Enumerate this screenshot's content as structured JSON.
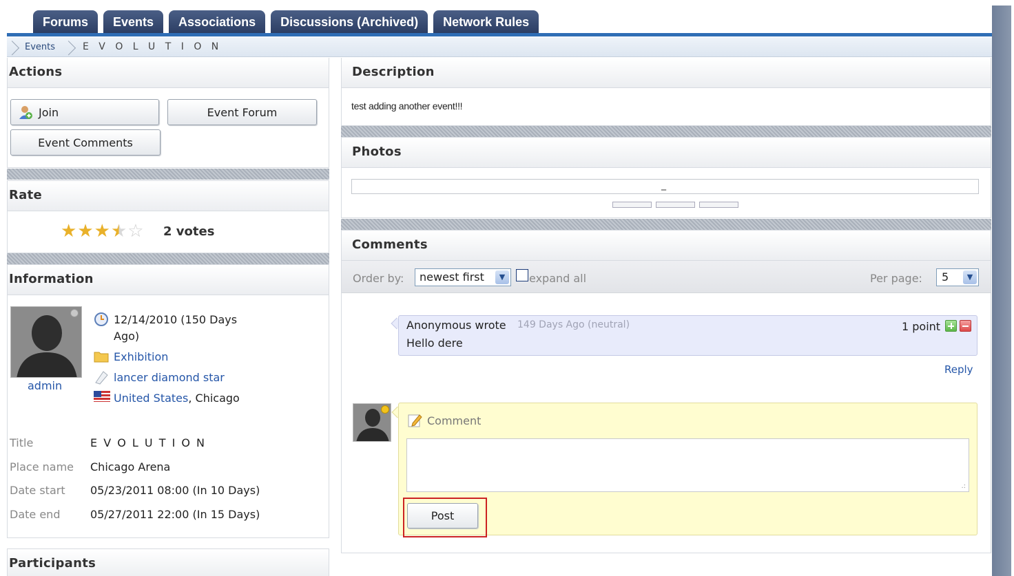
{
  "tabs": [
    {
      "label": "Forums"
    },
    {
      "label": "Events"
    },
    {
      "label": "Associations"
    },
    {
      "label": "Discussions (Archived)"
    },
    {
      "label": "Network Rules"
    }
  ],
  "breadcrumb": {
    "parent": "Events",
    "current": "E V O L U T I O N"
  },
  "actions": {
    "title": "Actions",
    "join_label": "Join",
    "forum_label": "Event Forum",
    "comments_label": "Event Comments"
  },
  "rate": {
    "title": "Rate",
    "rating": 3.5,
    "max": 5,
    "votes_label": "2 votes"
  },
  "information": {
    "title": "Information",
    "user_name": "admin",
    "date_line1": "12/14/2010 (150 Days",
    "date_line2": "Ago)",
    "category": "Exhibition",
    "tag": "lancer diamond star",
    "country": "United States",
    "city": ", Chicago",
    "fields": [
      {
        "label": "Title",
        "value": "E V O L U T I O N"
      },
      {
        "label": "Place name",
        "value": "Chicago Arena"
      },
      {
        "label": "Date start",
        "value": "05/23/2011 08:00 (In 10 Days)"
      },
      {
        "label": "Date end",
        "value": "05/27/2011 22:00 (In 15 Days)"
      }
    ]
  },
  "participants": {
    "title": "Participants"
  },
  "description": {
    "title": "Description",
    "text": "test adding another event!!!"
  },
  "photos": {
    "title": "Photos",
    "marker": "_"
  },
  "comments": {
    "title": "Comments",
    "order_label": "Order by:",
    "order_value": "newest first",
    "expand_label": "expand all",
    "per_page_label": "Per page:",
    "per_page_value": "5",
    "items": [
      {
        "author": "Anonymous wrote",
        "meta": "149 Days Ago (neutral)",
        "text": "Hello dere",
        "points": "1 point",
        "reply": "Reply"
      }
    ],
    "form": {
      "label": "Comment",
      "post_label": "Post"
    }
  },
  "colors": {
    "tab_bg": "#2c3e63",
    "accent": "#2f6db5",
    "comment_bg": "#e8ebfb",
    "reply_bg": "#fffdd0",
    "highlight": "#cc2222"
  }
}
